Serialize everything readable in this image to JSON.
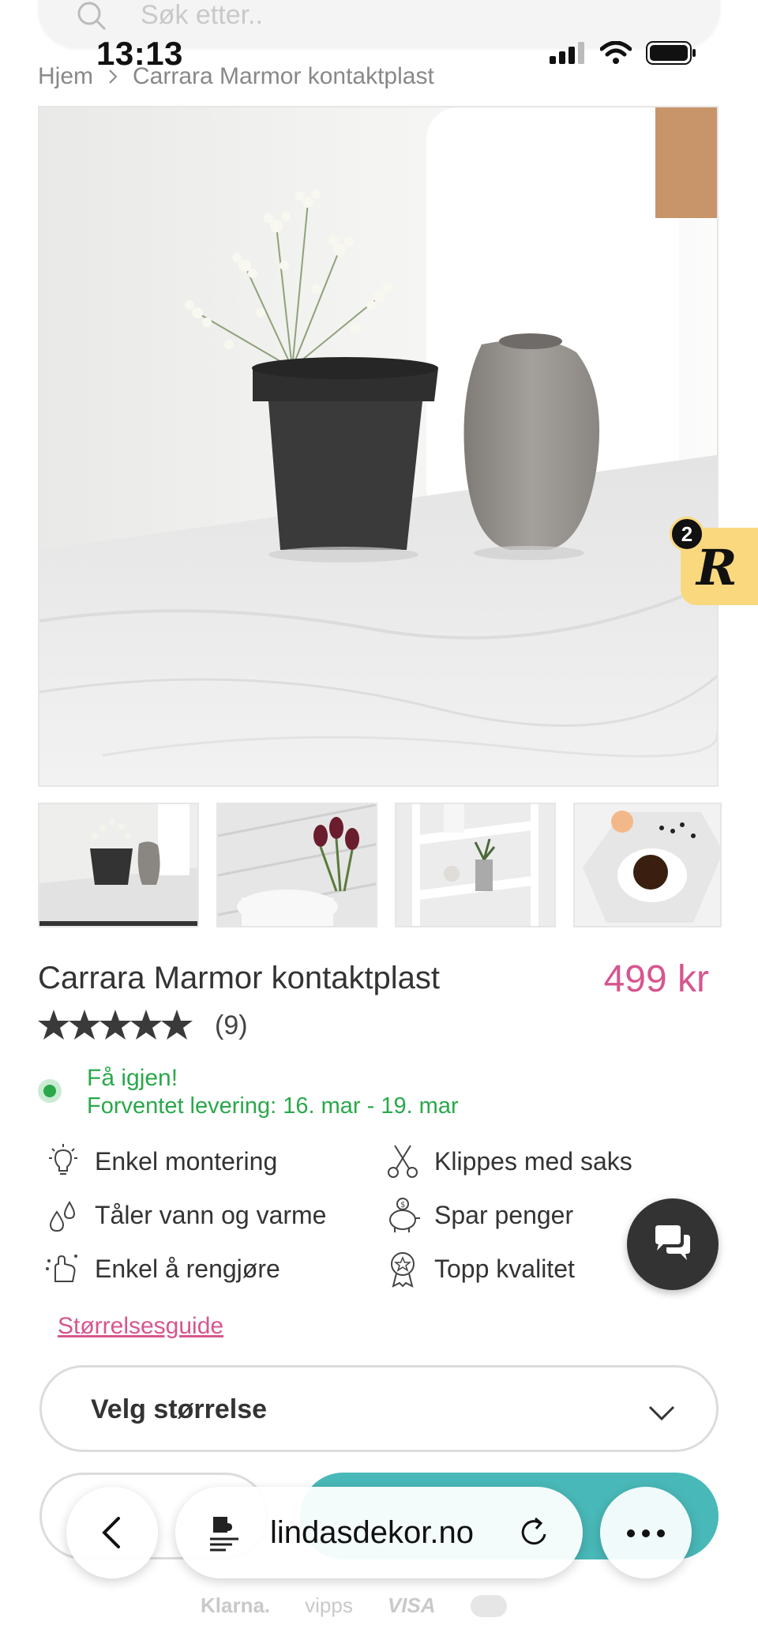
{
  "search": {
    "placeholder": "Søk etter.."
  },
  "status_bar": {
    "time": "13:13"
  },
  "breadcrumb": {
    "home": "Hjem",
    "current": "Carrara Marmor kontaktplast"
  },
  "hero_badge": {
    "count": "2",
    "letter": "R"
  },
  "product": {
    "title": "Carrara Marmor kontaktplast",
    "price": "499 kr",
    "rating": 5,
    "review_count": "(9)",
    "stock_status": "Få igjen!",
    "delivery": "Forventet levering: 16. mar - 19. mar"
  },
  "features": [
    {
      "icon": "lightbulb-icon",
      "label": "Enkel montering"
    },
    {
      "icon": "scissors-icon",
      "label": "Klippes med saks"
    },
    {
      "icon": "water-drops-icon",
      "label": "Tåler vann og varme"
    },
    {
      "icon": "piggy-bank-icon",
      "label": "Spar penger"
    },
    {
      "icon": "clean-hand-icon",
      "label": "Enkel å rengjøre"
    },
    {
      "icon": "award-badge-icon",
      "label": "Topp kvalitet"
    }
  ],
  "size_guide_label": "Størrelsesguide",
  "size_select": {
    "label": "Velg størrelse"
  },
  "payments": [
    "Klarna.",
    "vipps",
    "VISA"
  ],
  "browser": {
    "url": "lindasdekor.no"
  },
  "colors": {
    "accent_pink": "#d6568f",
    "stock_green": "#2aa84a",
    "buy_teal": "#49b8b8",
    "badge_yellow": "#f9d87e"
  }
}
